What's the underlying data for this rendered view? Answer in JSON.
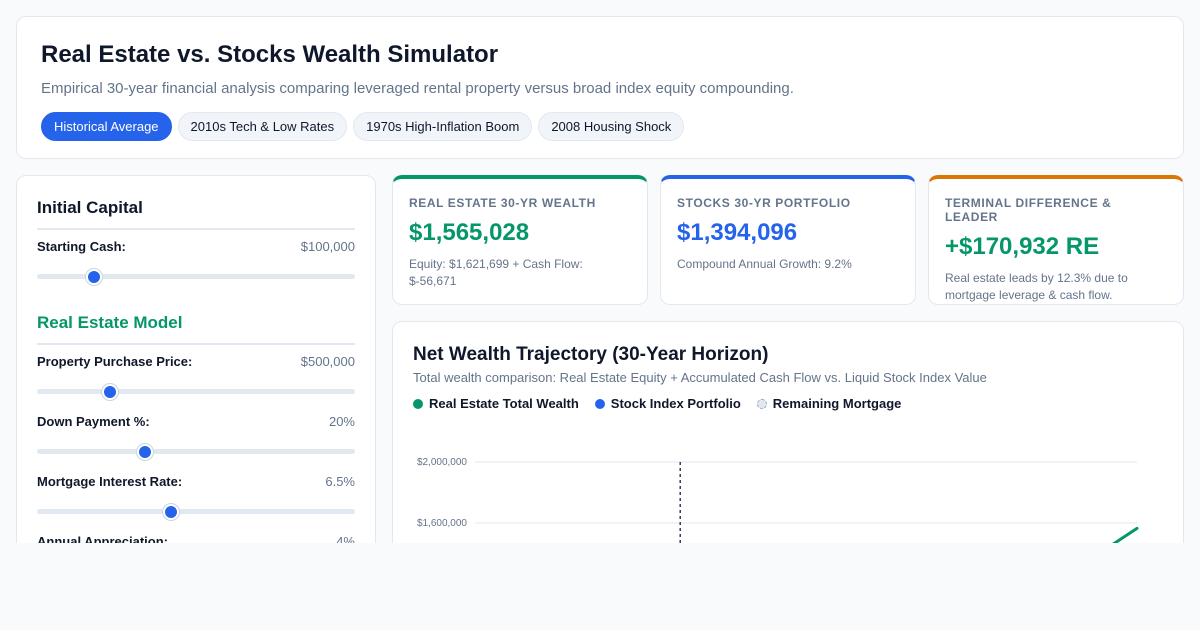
{
  "header": {
    "title": "Real Estate vs. Stocks Wealth Simulator",
    "subtitle": "Empirical 30-year financial analysis comparing leveraged rental property versus broad index equity compounding.",
    "tabs": [
      {
        "label": "Historical Average",
        "active": true
      },
      {
        "label": "2010s Tech & Low Rates",
        "active": false
      },
      {
        "label": "1970s High-Inflation Boom",
        "active": false
      },
      {
        "label": "2008 Housing Shock",
        "active": false
      }
    ]
  },
  "sidebar": {
    "capital": {
      "title": "Initial Capital",
      "starting_cash": {
        "label": "Starting Cash:",
        "value": "$100,000",
        "level": 0.18
      }
    },
    "real_estate": {
      "title": "Real Estate Model",
      "purchase_price": {
        "label": "Property Purchase Price:",
        "value": "$500,000",
        "level": 0.23
      },
      "down_payment": {
        "label": "Down Payment %:",
        "value": "20%",
        "level": 0.34
      },
      "interest_rate": {
        "label": "Mortgage Interest Rate:",
        "value": "6.5%",
        "level": 0.42
      },
      "appreciation": {
        "label": "Annual Appreciation:",
        "value": "4%"
      }
    }
  },
  "stats": {
    "real_estate": {
      "label": "Real Estate 30-Yr Wealth",
      "value": "$1,565,028",
      "note": "Equity: $1,621,699 + Cash Flow: $-56,671"
    },
    "stocks": {
      "label": "Stocks 30-Yr Portfolio",
      "value": "$1,394,096",
      "note": "Compound Annual Growth: 9.2%"
    },
    "difference": {
      "label": "Terminal Difference & Leader",
      "value": "+$170,932 RE",
      "note": "Real estate leads by 12.3% due to mortgage leverage & cash flow."
    }
  },
  "chart": {
    "title": "Net Wealth Trajectory (30-Year Horizon)",
    "subtitle": "Total wealth comparison: Real Estate Equity + Accumulated Cash Flow vs. Liquid Stock Index Value",
    "legend": [
      {
        "label": "Real Estate Total Wealth",
        "color": "#059669"
      },
      {
        "label": "Stock Index Portfolio",
        "color": "#2563eb"
      },
      {
        "label": "Remaining Mortgage",
        "color": "#e2e8f0"
      }
    ]
  },
  "chart_data": {
    "type": "line",
    "title": "Net Wealth Trajectory (30-Year Horizon)",
    "y_ticks": [
      "$2,000,000",
      "$1,600,000"
    ],
    "y_tick_values": [
      2000000,
      1600000
    ],
    "ylim": [
      0,
      2000000
    ],
    "x_range": [
      0,
      30
    ],
    "marker_year": 9.3,
    "series": [
      {
        "name": "Real Estate Total Wealth",
        "color": "#059669",
        "x": [
          28.9,
          30
        ],
        "values": [
          1460000,
          1565028
        ]
      }
    ],
    "grid": true
  }
}
